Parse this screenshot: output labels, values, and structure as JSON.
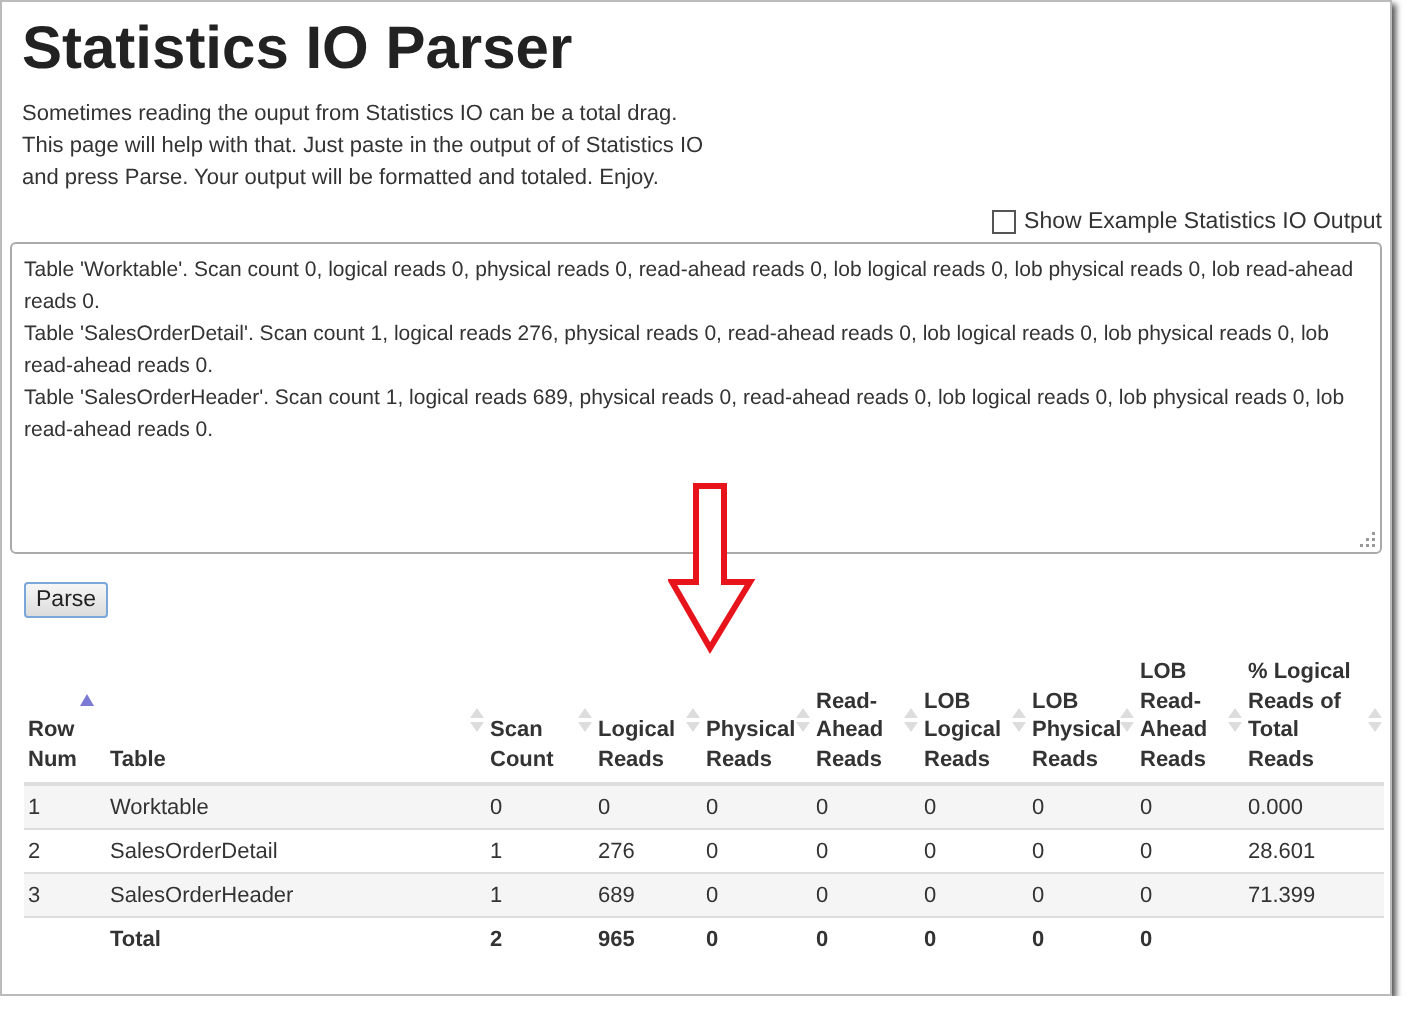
{
  "title": "Statistics IO Parser",
  "intro": [
    "Sometimes reading the ouput from Statistics IO can be a total drag.",
    "This page will help with that. Just paste in the output of of Statistics IO",
    "and press Parse. Your output will be formatted and totaled. Enjoy."
  ],
  "example_toggle": {
    "label": "Show Example Statistics IO Output",
    "checked": false
  },
  "input": {
    "value": "Table 'Worktable'. Scan count 0, logical reads 0, physical reads 0, read-ahead reads 0, lob logical reads 0, lob physical reads 0, lob read-ahead reads 0.\nTable 'SalesOrderDetail'. Scan count 1, logical reads 276, physical reads 0, read-ahead reads 0, lob logical reads 0, lob physical reads 0, lob read-ahead reads 0.\nTable 'SalesOrderHeader'. Scan count 1, logical reads 689, physical reads 0, read-ahead reads 0, lob logical reads 0, lob physical reads 0, lob read-ahead reads 0."
  },
  "parse_button": "Parse",
  "table": {
    "columns": [
      {
        "label": "Row Num",
        "sorted": true
      },
      {
        "label": "Table",
        "sorted": false
      },
      {
        "label": "Scan Count",
        "sorted": false
      },
      {
        "label": "Logical Reads",
        "sorted": false
      },
      {
        "label": "Physical Reads",
        "sorted": false
      },
      {
        "label": "Read-Ahead Reads",
        "sorted": false
      },
      {
        "label": "LOB Logical Reads",
        "sorted": false
      },
      {
        "label": "LOB Physical Reads",
        "sorted": false
      },
      {
        "label": "LOB Read-Ahead Reads",
        "sorted": false
      },
      {
        "label": "% Logical Reads of Total Reads",
        "sorted": false
      }
    ],
    "rows": [
      [
        "1",
        "Worktable",
        "0",
        "0",
        "0",
        "0",
        "0",
        "0",
        "0",
        "0.000"
      ],
      [
        "2",
        "SalesOrderDetail",
        "1",
        "276",
        "0",
        "0",
        "0",
        "0",
        "0",
        "28.601"
      ],
      [
        "3",
        "SalesOrderHeader",
        "1",
        "689",
        "0",
        "0",
        "0",
        "0",
        "0",
        "71.399"
      ]
    ],
    "total": {
      "label": "Total",
      "values": [
        "2",
        "965",
        "0",
        "0",
        "0",
        "0",
        "0"
      ]
    }
  }
}
